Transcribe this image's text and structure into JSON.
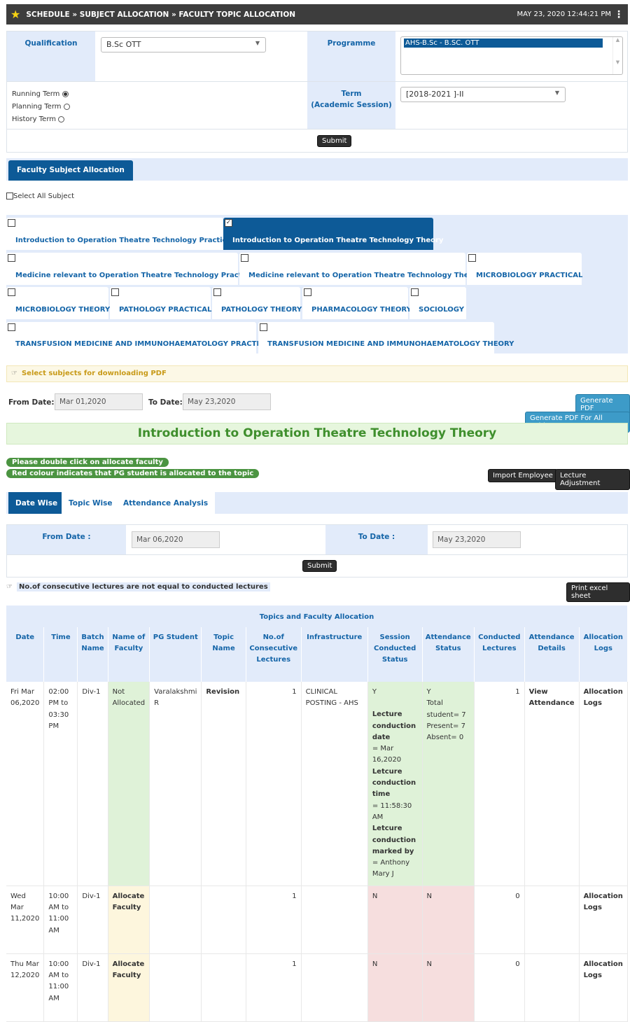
{
  "header": {
    "breadcrumb": "SCHEDULE » SUBJECT ALLOCATION » FACULTY TOPIC ALLOCATION",
    "datetime": "MAY 23, 2020  12:44:21 PM"
  },
  "filter": {
    "qualification_label": "Qualification",
    "qualification_value": "B.Sc OTT",
    "programme_label": "Programme",
    "programme_value": "AHS-B.Sc - B.SC. OTT",
    "running_term": "Running Term",
    "planning_term": "Planning Term",
    "history_term": "History Term",
    "term_label": "Term",
    "term_sub": "(Academic Session)",
    "term_value": "[2018-2021 ]-II",
    "submit": "Submit"
  },
  "fsa_tab": "Faculty Subject Allocation",
  "select_all": "Select All Subject",
  "subjects": [
    "Introduction to Operation Theatre Technology Practical",
    "Introduction to Operation Theatre Technology Theory",
    "Medicine relevant to Operation Theatre Technology Practical",
    "Medicine relevant to Operation Theatre Technology Theory",
    "MICROBIOLOGY PRACTICAL",
    "MICROBIOLOGY THEORY",
    "PATHOLOGY PRACTICAL",
    "PATHOLOGY THEORY",
    "PHARMACOLOGY THEORY",
    "SOCIOLOGY",
    "TRANSFUSION MEDICINE AND IMMUNOHAEMATOLOGY PRACTICAL",
    "TRANSFUSION MEDICINE AND IMMUNOHAEMATOLOGY THEORY"
  ],
  "pdf_note": "Select subjects for downloading PDF",
  "from_label": "From Date:",
  "from_value": "Mar 01,2020",
  "to_label": "To Date:",
  "to_value": "May 23,2020",
  "gen_pdf": "Generate PDF",
  "gen_pdf_all": "Generate PDF For All Subject",
  "subject_title": "Introduction to Operation Theatre Technology Theory",
  "pill1": "Please double click on allocate faculty",
  "pill2": "Red colour indicates that PG student is allocated to the topic",
  "import_emp": "Import Employee",
  "lecture_adj": "Lecture Adjustment",
  "tabs": [
    "Date Wise",
    "Topic Wise",
    "Attendance Analysis"
  ],
  "range": {
    "from_label": "From Date :",
    "from_value": "Mar 06,2020",
    "to_label": "To Date :",
    "to_value": "May 23,2020",
    "submit": "Submit"
  },
  "warn": "No.of consecutive lectures are not equal to conducted lectures",
  "print": "Print excel sheet",
  "table": {
    "caption": "Topics and Faculty Allocation",
    "headers": [
      "Date",
      "Time",
      "Batch Name",
      "Name of Faculty",
      "PG Student",
      "Topic Name",
      "No.of Consecutive Lectures",
      "Infrastructure",
      "Session Conducted Status",
      "Attendance Status",
      "Conducted Lectures",
      "Attendance Details",
      "Allocation Logs"
    ],
    "rows": [
      {
        "date": "Fri Mar 06,2020",
        "time": "02:00 PM to 03:30 PM",
        "batch": "Div-1",
        "faculty": "Not Allocated",
        "pg": "Varalakshmi R",
        "topic": "Revision",
        "consec": "1",
        "infra": "CLINICAL POSTING - AHS",
        "status": "Y",
        "lcd_l": "Lecture conduction date",
        "lcd_v": "= Mar 16,2020",
        "lct_l": "Letcure conduction time",
        "lct_v": "= 11:58:30 AM",
        "lmb_l": "Letcure conduction marked by",
        "lmb_v": "= Anthony Mary J",
        "att": "Y",
        "att_total": "Total student= 7",
        "att_present": "Present= 7",
        "att_absent": "Absent= 0",
        "conducted": "1",
        "details": "View Attendance",
        "logs": "Allocation Logs"
      },
      {
        "date": "Wed Mar 11,2020",
        "time": "10:00 AM to 11:00 AM",
        "batch": "Div-1",
        "faculty": "Allocate Faculty",
        "consec": "1",
        "status": "N",
        "att": "N",
        "conducted": "0",
        "logs": "Allocation Logs"
      },
      {
        "date": "Thu Mar 12,2020",
        "time": "10:00 AM to 11:00 AM",
        "batch": "Div-1",
        "faculty": "Allocate Faculty",
        "consec": "1",
        "status": "N",
        "att": "N",
        "conducted": "0",
        "logs": "Allocation Logs"
      }
    ]
  }
}
